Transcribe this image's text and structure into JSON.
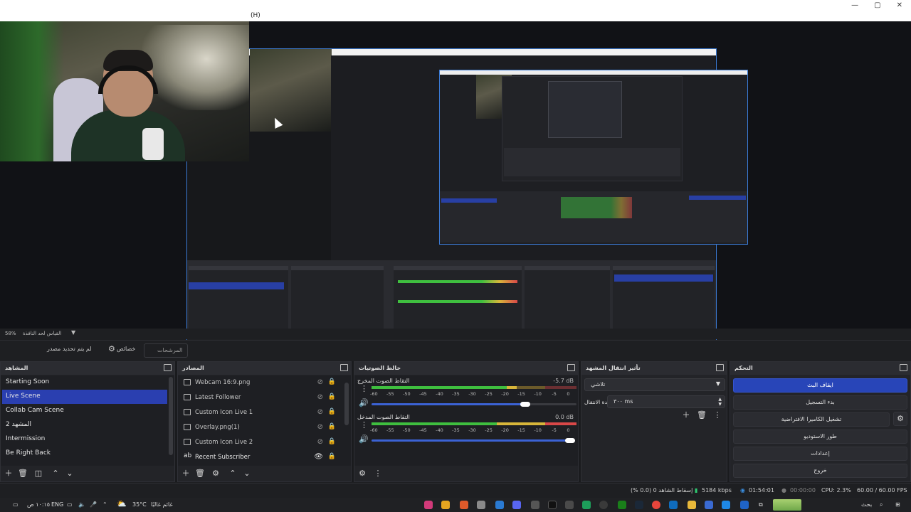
{
  "window": {
    "menu_text": "(H)",
    "controls": [
      "—",
      "▢",
      "✕"
    ]
  },
  "preview": {
    "zoom": "58%",
    "zoom_label": "القياس لحد النافذة"
  },
  "toolbar": {
    "no_source": "لم يتم تحديد مصدر",
    "properties": "خصائص",
    "filters": "المرشحات"
  },
  "docks": {
    "scenes": {
      "title": "المشاهد",
      "items": [
        "Starting Soon",
        "Live Scene",
        "Collab Cam Scene",
        "المشهد 2",
        "Intermission",
        "Be Right Back"
      ],
      "active_index": 1
    },
    "sources": {
      "title": "المصادر",
      "items": [
        "Webcam 16:9.png",
        "Latest Follower",
        "Custom Icon Live 1",
        "Overlay.png(1)",
        "Custom Icon Live 2",
        "Recent Subscriber"
      ]
    },
    "mixer": {
      "title": "خالط الصوتيات",
      "channels": [
        {
          "label": "التقاط الصوت المخرج",
          "db": "-5.7 dB",
          "level": 0.71,
          "volume": 0.68
        },
        {
          "label": "التقاط الصوت المدخل",
          "db": "0.0 dB",
          "level": 1.0,
          "volume": 1.0
        }
      ],
      "ticks": [
        "-60",
        "-55",
        "-50",
        "-45",
        "-40",
        "-35",
        "-30",
        "-25",
        "-20",
        "-15",
        "-10",
        "-5",
        "0"
      ]
    },
    "transitions": {
      "title": "تأثير انتقال المشهد",
      "type": "تلاشي",
      "duration_label": "مدة الانتقال",
      "duration": "٣٠٠ ms"
    },
    "controls": {
      "title": "التحكم",
      "buttons": [
        "ايقاف البث",
        "بدء التسجيل",
        "تشغيل الكاميرا الافتراضية",
        "طور الاستوديو",
        "إعدادات",
        "خروج"
      ]
    }
  },
  "status": {
    "dropped": "إسقاط الشاهد 0 (0.0 %)",
    "bitrate": "5184 kbps",
    "stream_time": "01:54:01",
    "rec_time": "00:00:00",
    "cpu": "CPU: 2.3%",
    "fps": "60.00 / 60.00 FPS"
  },
  "taskbar": {
    "time": "١٠:١٥ ص",
    "lang": "ENG",
    "weather": "35°C",
    "weather_text": "غائم غالبًا",
    "search": "بحث"
  },
  "colors": {
    "accent": "#2a3fb0",
    "meter_green": "#3fbf3f",
    "meter_yellow": "#d8b63a",
    "meter_red": "#d94848"
  }
}
